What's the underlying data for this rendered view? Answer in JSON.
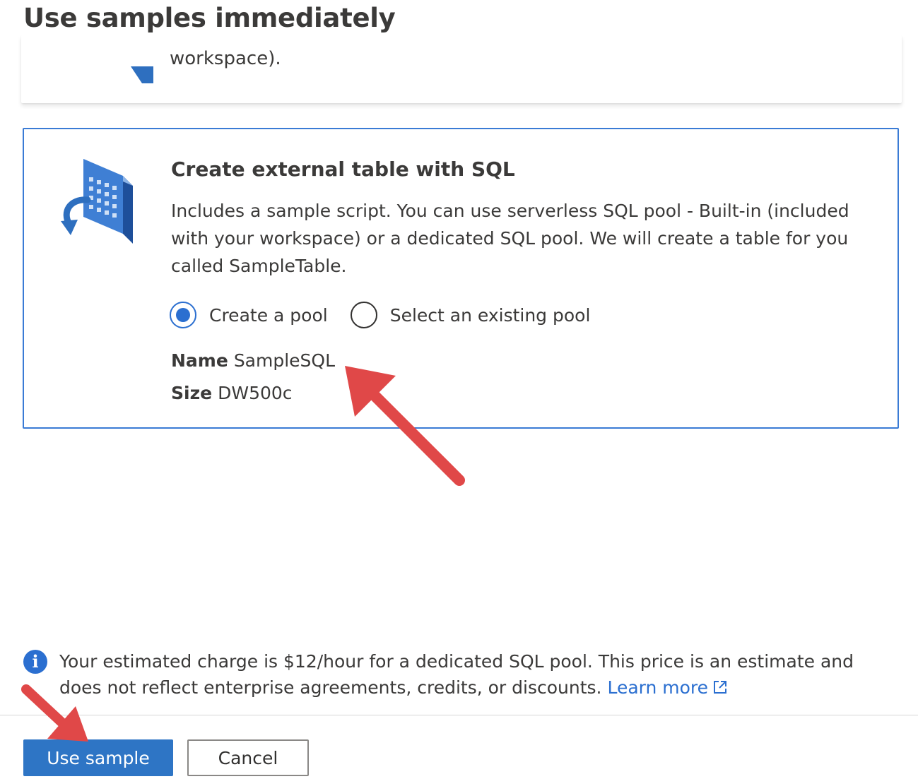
{
  "page": {
    "title": "Use samples immediately"
  },
  "previous_card": {
    "text_fragment": "workspace)."
  },
  "sample_card": {
    "title": "Create external table with SQL",
    "description": "Includes a sample script. You can use serverless SQL pool - Built-in (included with your workspace) or a dedicated SQL pool. We will create a table for you called SampleTable.",
    "icon": "database-building-icon",
    "pool_options": [
      {
        "label": "Create a pool",
        "selected": true
      },
      {
        "label": "Select an existing pool",
        "selected": false
      }
    ],
    "properties": {
      "name_label": "Name",
      "name_value": "SampleSQL",
      "size_label": "Size",
      "size_value": "DW500c"
    }
  },
  "info_banner": {
    "icon": "info-icon",
    "text": "Your estimated charge is $12/hour for a dedicated SQL pool. This price is an estimate and does not reflect enterprise agreements, credits, or discounts. ",
    "link_label": "Learn more",
    "link_icon": "external-link-icon"
  },
  "footer": {
    "primary_label": "Use sample",
    "secondary_label": "Cancel"
  },
  "colors": {
    "accent": "#2b6fd0",
    "primary_button": "#2e75c5",
    "selected_border": "#3a7bd5",
    "annotation_arrow": "#e04848"
  }
}
